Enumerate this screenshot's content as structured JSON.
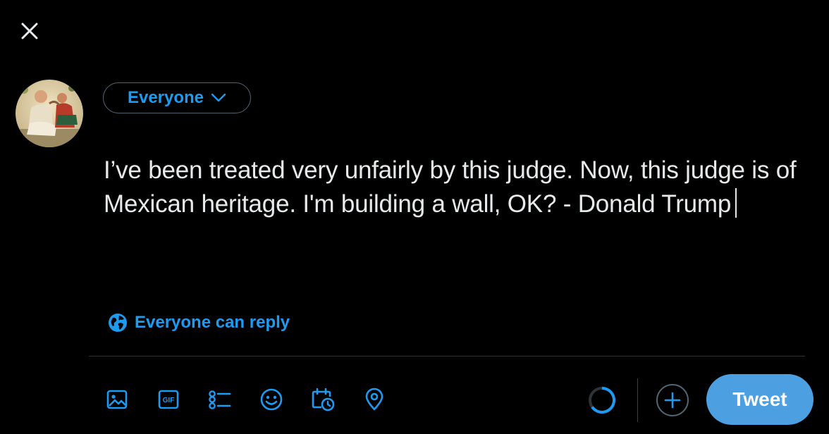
{
  "compose": {
    "audience_label": "Everyone",
    "text": "I’ve been treated very unfairly by this judge. Now, this judge is of Mexican heritage. I'm building a wall, OK? - Donald Trump",
    "reply_setting_label": "Everyone can reply",
    "tweet_button_label": "Tweet"
  },
  "toolbar": {
    "icons": [
      "image-icon",
      "gif-icon",
      "poll-icon",
      "emoji-icon",
      "schedule-icon",
      "location-icon"
    ],
    "gif_glyph": "GIF"
  },
  "colors": {
    "accent": "#1d9bf0",
    "background": "#000000",
    "text": "#e7e9ea",
    "tweet_button": "#4c9fe0"
  }
}
